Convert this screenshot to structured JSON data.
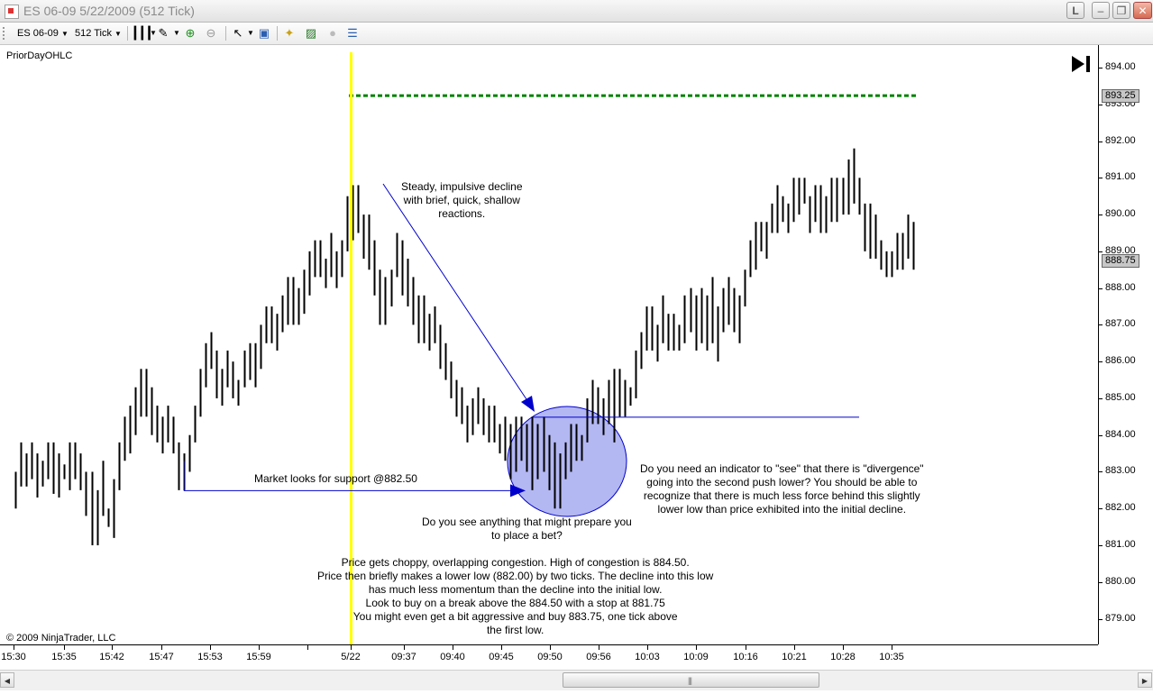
{
  "window": {
    "title": "ES 06-09  5/22/2009 (512 Tick)",
    "btn_l": "L"
  },
  "toolbar": {
    "instrument": "ES 06-09",
    "period": "512 Tick"
  },
  "indicator_label": "PriorDayOHLC",
  "copyright": "© 2009 NinjaTrader, LLC",
  "yaxis": {
    "labels": [
      "894.00",
      "893.00",
      "892.00",
      "891.00",
      "890.00",
      "889.00",
      "888.00",
      "887.00",
      "886.00",
      "885.00",
      "884.00",
      "883.00",
      "882.00",
      "881.00",
      "880.00",
      "879.00"
    ],
    "price_marker_1": "893.25",
    "price_marker_2": "888.75"
  },
  "xaxis": {
    "labels": [
      "15:30",
      "15:35",
      "15:42",
      "15:47",
      "15:53",
      "15:59",
      "5/22",
      "09:37",
      "09:40",
      "09:45",
      "09:50",
      "09:56",
      "10:03",
      "10:09",
      "10:16",
      "10:21",
      "10:28",
      "10:35"
    ]
  },
  "annotations": {
    "decline": [
      "Steady, impulsive decline",
      "with brief, quick, shallow",
      "reactions."
    ],
    "support": "Market looks for support @882.50",
    "prepare": [
      "Do you see anything that might prepare you",
      "to place a bet?"
    ],
    "divergence": [
      "Do you need an indicator to \"see\" that there is \"divergence\"",
      "going into the second push lower?  You should be able to",
      "recognize that there is much less force behind this slightly",
      "lower low than price exhibited into the initial decline."
    ],
    "congestion": [
      "Price gets choppy, overlapping congestion.  High of congestion is 884.50.",
      "Price then briefly makes a lower low (882.00) by two ticks.  The decline into this low",
      "has much less momentum than the decline into the initial low.",
      "Look to buy on a break above the 884.50 with a stop at 881.75",
      "You might even get a bit aggressive and buy 883.75, one tick above",
      "the first low."
    ]
  },
  "colors": {
    "session_line": "#ffff00",
    "prior_level": "#008000",
    "annotation_line": "#0000cc",
    "circle_fill": "#b3b7f2"
  },
  "chart_data": {
    "type": "ohlc",
    "prior_day_level": 893.25,
    "support_level": 882.5,
    "congestion_high": 884.5,
    "bars": [
      [
        883.0,
        882.0
      ],
      [
        883.8,
        882.6
      ],
      [
        883.5,
        882.6
      ],
      [
        883.8,
        882.8
      ],
      [
        883.5,
        882.3
      ],
      [
        883.3,
        882.6
      ],
      [
        883.8,
        882.8
      ],
      [
        883.8,
        882.4
      ],
      [
        883.5,
        882.3
      ],
      [
        883.2,
        882.8
      ],
      [
        883.8,
        882.5
      ],
      [
        883.8,
        882.8
      ],
      [
        883.5,
        882.5
      ],
      [
        883.0,
        881.8
      ],
      [
        883.0,
        881.0
      ],
      [
        882.5,
        881.0
      ],
      [
        883.3,
        881.8
      ],
      [
        882.0,
        881.5
      ],
      [
        882.8,
        881.2
      ],
      [
        883.8,
        882.5
      ],
      [
        884.5,
        883.3
      ],
      [
        884.8,
        883.5
      ],
      [
        885.3,
        884.0
      ],
      [
        885.8,
        884.5
      ],
      [
        885.8,
        884.5
      ],
      [
        885.3,
        884.0
      ],
      [
        884.8,
        883.8
      ],
      [
        884.5,
        883.5
      ],
      [
        884.8,
        883.8
      ],
      [
        884.5,
        883.5
      ],
      [
        883.8,
        882.5
      ],
      [
        883.5,
        882.5
      ],
      [
        884.0,
        883.0
      ],
      [
        884.8,
        883.8
      ],
      [
        885.8,
        884.5
      ],
      [
        886.5,
        885.3
      ],
      [
        886.8,
        885.8
      ],
      [
        886.3,
        885.0
      ],
      [
        885.8,
        884.8
      ],
      [
        886.3,
        885.3
      ],
      [
        886.0,
        885.0
      ],
      [
        885.5,
        884.8
      ],
      [
        886.3,
        885.3
      ],
      [
        886.5,
        885.5
      ],
      [
        886.5,
        885.3
      ],
      [
        887.0,
        885.8
      ],
      [
        887.5,
        886.5
      ],
      [
        887.5,
        886.5
      ],
      [
        887.3,
        886.3
      ],
      [
        887.8,
        886.8
      ],
      [
        888.3,
        887.0
      ],
      [
        888.3,
        887.0
      ],
      [
        888.0,
        887.0
      ],
      [
        888.5,
        887.3
      ],
      [
        889.0,
        887.8
      ],
      [
        889.3,
        888.3
      ],
      [
        889.3,
        888.3
      ],
      [
        888.8,
        888.0
      ],
      [
        889.5,
        888.3
      ],
      [
        889.0,
        888.0
      ],
      [
        889.3,
        888.3
      ],
      [
        890.5,
        889.0
      ],
      [
        890.8,
        889.3
      ],
      [
        890.8,
        889.5
      ],
      [
        890.0,
        888.8
      ],
      [
        890.0,
        888.5
      ],
      [
        889.3,
        887.8
      ],
      [
        888.5,
        887.0
      ],
      [
        888.3,
        887.0
      ],
      [
        888.5,
        887.5
      ],
      [
        889.5,
        888.3
      ],
      [
        889.3,
        887.8
      ],
      [
        888.8,
        887.5
      ],
      [
        888.3,
        887.0
      ],
      [
        887.8,
        886.5
      ],
      [
        887.8,
        886.5
      ],
      [
        887.3,
        886.3
      ],
      [
        887.5,
        886.5
      ],
      [
        887.0,
        885.8
      ],
      [
        886.5,
        885.5
      ],
      [
        886.0,
        885.0
      ],
      [
        885.5,
        884.5
      ],
      [
        885.3,
        884.3
      ],
      [
        884.8,
        883.8
      ],
      [
        885.0,
        884.0
      ],
      [
        885.3,
        884.3
      ],
      [
        885.0,
        884.0
      ],
      [
        884.8,
        883.8
      ],
      [
        884.8,
        883.8
      ],
      [
        884.3,
        883.5
      ],
      [
        884.5,
        883.3
      ],
      [
        884.3,
        882.8
      ],
      [
        884.5,
        883.0
      ],
      [
        884.5,
        883.3
      ],
      [
        884.3,
        883.0
      ],
      [
        884.5,
        882.5
      ],
      [
        884.3,
        882.8
      ],
      [
        884.5,
        883.0
      ],
      [
        884.0,
        882.5
      ],
      [
        883.8,
        882.0
      ],
      [
        883.5,
        882.0
      ],
      [
        883.8,
        882.8
      ],
      [
        884.3,
        883.0
      ],
      [
        884.3,
        883.3
      ],
      [
        884.0,
        883.3
      ],
      [
        885.0,
        883.8
      ],
      [
        885.5,
        884.3
      ],
      [
        885.3,
        884.3
      ],
      [
        885.0,
        884.0
      ],
      [
        885.5,
        884.3
      ],
      [
        885.8,
        883.8
      ],
      [
        885.8,
        884.5
      ],
      [
        885.5,
        884.5
      ],
      [
        885.3,
        884.8
      ],
      [
        886.3,
        885.0
      ],
      [
        886.8,
        885.8
      ],
      [
        887.5,
        886.3
      ],
      [
        887.5,
        886.3
      ],
      [
        887.0,
        886.0
      ],
      [
        887.8,
        886.5
      ],
      [
        887.3,
        886.3
      ],
      [
        887.3,
        886.3
      ],
      [
        887.0,
        886.3
      ],
      [
        887.8,
        886.5
      ],
      [
        888.0,
        886.8
      ],
      [
        887.8,
        886.3
      ],
      [
        888.0,
        886.5
      ],
      [
        887.8,
        886.3
      ],
      [
        888.3,
        886.5
      ],
      [
        887.5,
        886.0
      ],
      [
        888.0,
        886.8
      ],
      [
        888.3,
        887.0
      ],
      [
        888.0,
        886.8
      ],
      [
        887.8,
        886.5
      ],
      [
        888.5,
        887.5
      ],
      [
        889.3,
        888.3
      ],
      [
        889.8,
        888.5
      ],
      [
        889.8,
        889.0
      ],
      [
        889.8,
        888.8
      ],
      [
        890.3,
        889.5
      ],
      [
        890.8,
        889.5
      ],
      [
        890.5,
        889.8
      ],
      [
        890.3,
        889.5
      ],
      [
        891.0,
        889.8
      ],
      [
        891.0,
        890.0
      ],
      [
        891.0,
        890.3
      ],
      [
        890.5,
        889.5
      ],
      [
        890.8,
        889.8
      ],
      [
        890.8,
        889.5
      ],
      [
        890.5,
        889.5
      ],
      [
        891.0,
        889.8
      ],
      [
        891.0,
        889.8
      ],
      [
        891.0,
        890.0
      ],
      [
        891.5,
        890.0
      ],
      [
        891.8,
        890.3
      ],
      [
        891.0,
        890.0
      ],
      [
        890.3,
        889.0
      ],
      [
        890.3,
        888.8
      ],
      [
        890.0,
        888.8
      ],
      [
        889.3,
        888.5
      ],
      [
        889.0,
        888.3
      ],
      [
        889.0,
        888.3
      ],
      [
        889.5,
        888.5
      ],
      [
        889.5,
        888.5
      ],
      [
        890.0,
        888.8
      ],
      [
        889.8,
        888.5
      ]
    ]
  }
}
